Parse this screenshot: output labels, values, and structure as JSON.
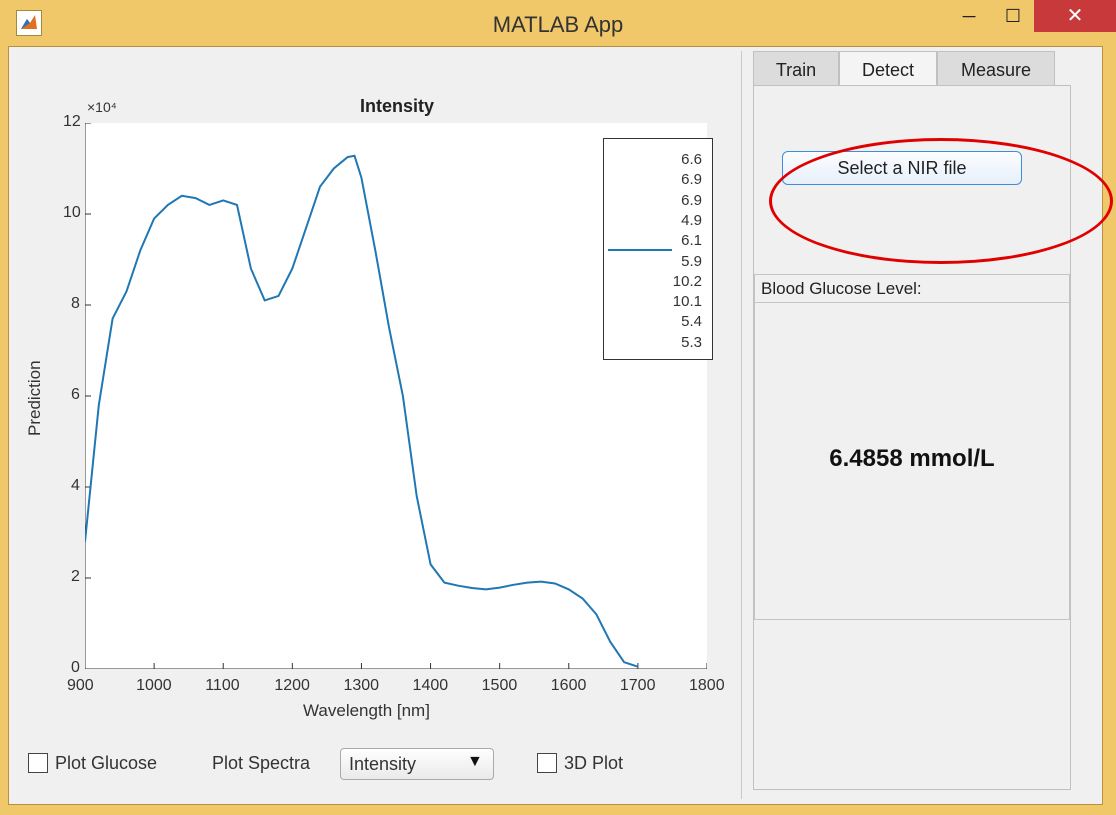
{
  "window": {
    "title": "MATLAB App",
    "min_label": "─",
    "max_label": "☐",
    "close_label": "✕"
  },
  "plot": {
    "title": "Intensity",
    "exponent_label": "×10⁴",
    "xlabel": "Wavelength [nm]",
    "ylabel": "Prediction",
    "xticks": [
      "900",
      "1000",
      "1100",
      "1200",
      "1300",
      "1400",
      "1500",
      "1600",
      "1700",
      "1800"
    ],
    "yticks": [
      "0",
      "2",
      "4",
      "6",
      "8",
      "10",
      "12"
    ],
    "legend": [
      "6.6",
      "6.9",
      "6.9",
      "4.9",
      "6.1",
      "5.9",
      "10.2",
      "10.1",
      "5.4",
      "5.3"
    ],
    "line_color": "#1f77b4"
  },
  "chart_data": {
    "type": "line",
    "title": "Intensity",
    "xlabel": "Wavelength [nm]",
    "ylabel": "Prediction",
    "xlim": [
      900,
      1800
    ],
    "ylim": [
      0,
      120000
    ],
    "series": [
      {
        "name": "6.1",
        "x": [
          900,
          920,
          940,
          960,
          980,
          1000,
          1020,
          1040,
          1060,
          1080,
          1100,
          1120,
          1140,
          1160,
          1180,
          1200,
          1220,
          1240,
          1260,
          1280,
          1290,
          1300,
          1320,
          1340,
          1360,
          1380,
          1400,
          1420,
          1440,
          1460,
          1480,
          1500,
          1520,
          1540,
          1560,
          1580,
          1600,
          1620,
          1640,
          1660,
          1680,
          1700
        ],
        "y": [
          28000,
          58000,
          77000,
          83000,
          92000,
          99000,
          102000,
          104000,
          103500,
          102000,
          103000,
          102000,
          88000,
          81000,
          82000,
          88000,
          97000,
          106000,
          110000,
          112500,
          112800,
          108000,
          92000,
          75000,
          60000,
          38000,
          23000,
          19000,
          18300,
          17800,
          17500,
          17900,
          18500,
          19000,
          19200,
          18800,
          17500,
          15500,
          12000,
          6000,
          1500,
          500
        ]
      }
    ]
  },
  "controls": {
    "plot_glucose_label": "Plot Glucose",
    "plot_spectra_label": "Plot Spectra",
    "spectra_selected": "Intensity",
    "plot3d_label": "3D Plot"
  },
  "tabs": [
    "Train",
    "Detect",
    "Measure"
  ],
  "detect": {
    "select_button": "Select a NIR file",
    "panel_title": "Blood Glucose Level:",
    "value": "6.4858 mmol/L"
  }
}
